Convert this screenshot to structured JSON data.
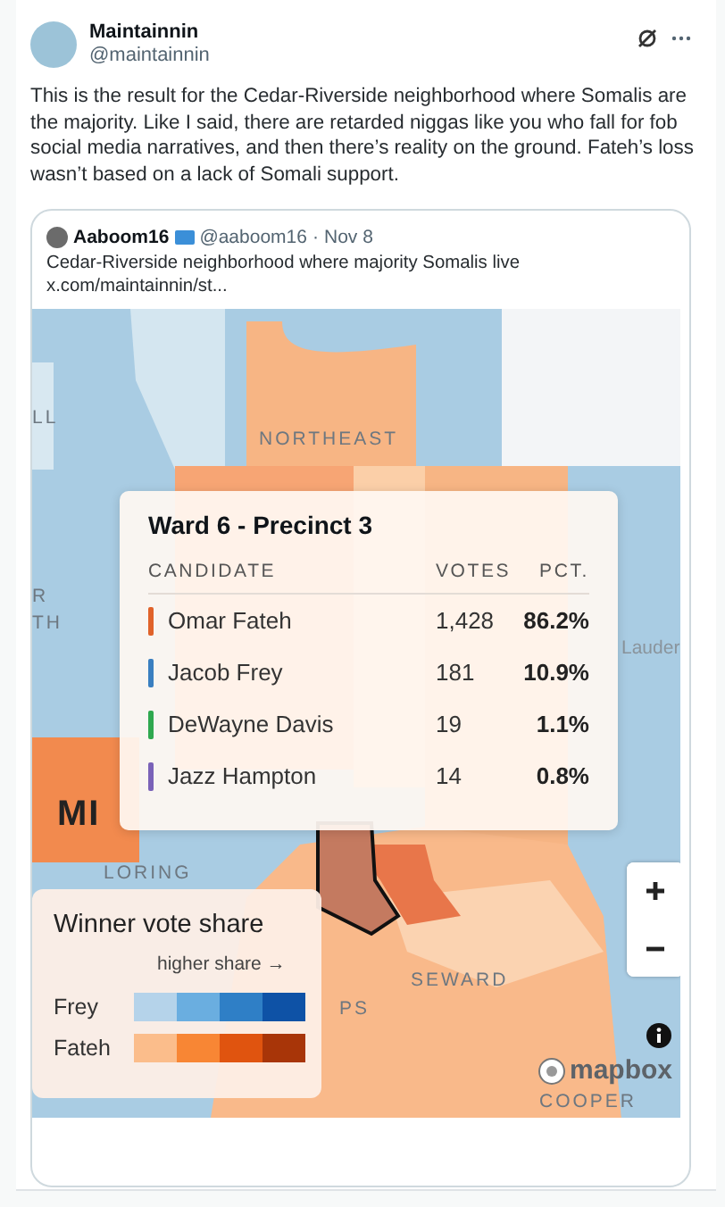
{
  "post": {
    "display_name": "Maintainnin",
    "handle": "@maintainnin",
    "body": "This is the result for the Cedar-Riverside neighborhood where Somalis are the majority. Like I said, there are retarded niggas like you who fall for fob social media narratives, and then there’s reality on the ground. Fateh’s loss wasn’t based on a lack of Somali support."
  },
  "quoted_post": {
    "display_name": "Aaboom16",
    "handle": "@aaboom16",
    "separator": "·",
    "date": "Nov 8",
    "text": "Cedar-Riverside neighborhood where majority Somalis live",
    "link": "x.com/maintainnin/st..."
  },
  "map": {
    "labels": [
      {
        "text": "LL"
      },
      {
        "text": "NORTHEAST"
      },
      {
        "text": "R"
      },
      {
        "text": "TH"
      },
      {
        "text": "Lauder"
      },
      {
        "text": "MI"
      },
      {
        "text": "LORING"
      },
      {
        "text": "SEWARD"
      },
      {
        "text": "PS"
      },
      {
        "text": "COOPER"
      }
    ],
    "results_card": {
      "title": "Ward 6 - Precinct 3",
      "columns": [
        "CANDIDATE",
        "VOTES",
        "PCT."
      ],
      "rows": [
        {
          "name": "Omar Fateh",
          "color": "#e0622a",
          "votes": "1,428",
          "pct": "86.2%"
        },
        {
          "name": "Jacob Frey",
          "color": "#3a7fc0",
          "votes": "181",
          "pct": "10.9%"
        },
        {
          "name": "DeWayne Davis",
          "color": "#2fa84f",
          "votes": "19",
          "pct": "1.1%"
        },
        {
          "name": "Jazz Hampton",
          "color": "#7a62b8",
          "votes": "14",
          "pct": "0.8%"
        }
      ]
    },
    "legend": {
      "title": "Winner vote share",
      "direction_label": "higher share →",
      "rows": [
        {
          "label": "Frey"
        },
        {
          "label": "Fateh"
        }
      ]
    },
    "logo_text": "mapbox"
  }
}
